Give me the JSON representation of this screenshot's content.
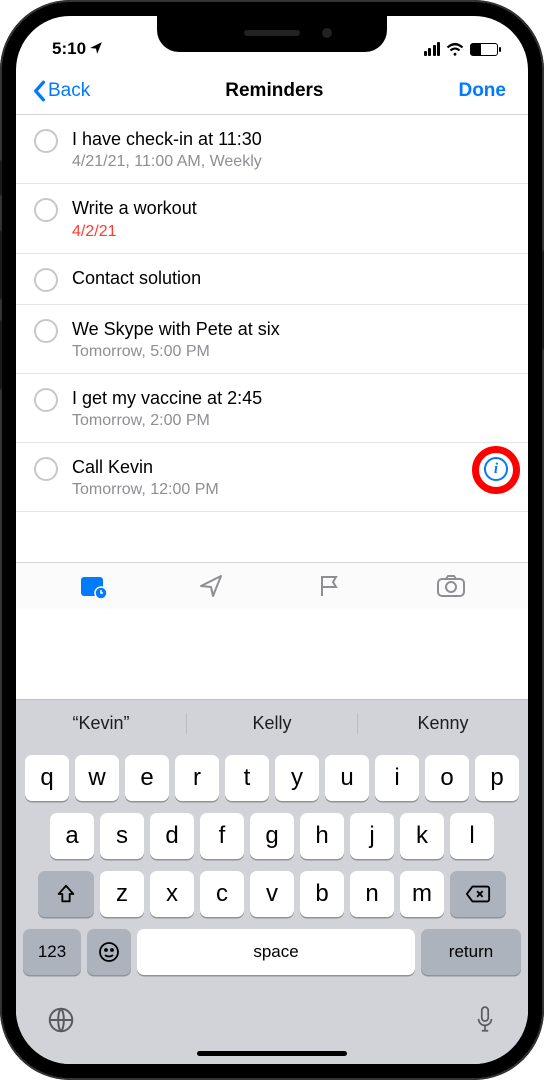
{
  "status": {
    "time": "5:10",
    "locationActive": true
  },
  "nav": {
    "back": "Back",
    "title": "Reminders",
    "done": "Done"
  },
  "reminders": [
    {
      "title": "I have check-in at 11:30",
      "sub": "4/21/21, 11:00 AM, Weekly",
      "overdue": false,
      "showInfo": false
    },
    {
      "title": "Write a workout",
      "sub": "4/2/21",
      "overdue": true,
      "showInfo": false
    },
    {
      "title": "Contact solution",
      "sub": "",
      "overdue": false,
      "showInfo": false
    },
    {
      "title": "We Skype with Pete at six",
      "sub": "Tomorrow, 5:00 PM",
      "overdue": false,
      "showInfo": false
    },
    {
      "title": "I get my vaccine at 2:45",
      "sub": "Tomorrow, 2:00 PM",
      "overdue": false,
      "showInfo": false
    },
    {
      "title": "Call Kevin",
      "sub": "Tomorrow, 12:00 PM",
      "overdue": false,
      "showInfo": true,
      "highlight": true
    }
  ],
  "toolbar": {
    "icons": [
      "calendar-icon",
      "location-icon",
      "flag-icon",
      "camera-icon"
    ],
    "activeIndex": 0
  },
  "keyboard": {
    "suggestions": [
      "“Kevin”",
      "Kelly",
      "Kenny"
    ],
    "row1": [
      "q",
      "w",
      "e",
      "r",
      "t",
      "y",
      "u",
      "i",
      "o",
      "p"
    ],
    "row2": [
      "a",
      "s",
      "d",
      "f",
      "g",
      "h",
      "j",
      "k",
      "l"
    ],
    "row3": [
      "z",
      "x",
      "c",
      "v",
      "b",
      "n",
      "m"
    ],
    "numKey": "123",
    "spaceKey": "space",
    "returnKey": "return"
  }
}
